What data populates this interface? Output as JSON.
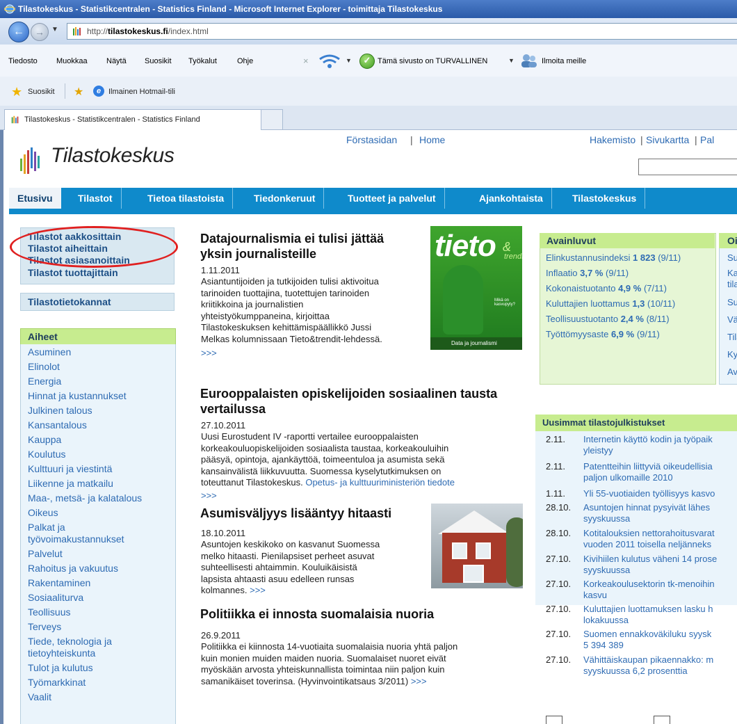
{
  "browser": {
    "title": "Tilastokeskus - Statistikcentralen - Statistics Finland - Microsoft Internet Explorer - toimittaja Tilastokeskus",
    "url_prefix": "http://",
    "url_host": "tilastokeskus.fi",
    "url_path": "/index.html",
    "menu": [
      "Tiedosto",
      "Muokkaa",
      "Näytä",
      "Suosikit",
      "Työkalut",
      "Ohje"
    ],
    "safe_site_text": "Tämä sivusto on TURVALLINEN",
    "report_text": "Ilmoita meille",
    "favorites_label": "Suosikit",
    "hotmail_label": "Ilmainen Hotmail-tili",
    "tab_label": "Tilastokeskus - Statistikcentralen - Statistics Finland"
  },
  "site": {
    "logo_text": "Tilastokeskus",
    "lang_links": [
      "Förstasidan",
      "Home"
    ],
    "util_links": [
      "Hakemisto",
      "Sivukartta",
      "Pal"
    ],
    "nav": [
      "Etusivu",
      "Tilastot",
      "Tietoa tilastoista",
      "Tiedonkeruut",
      "Tuotteet ja palvelut",
      "Ajankohtaista",
      "Tilastokeskus"
    ]
  },
  "left": {
    "stat_links": [
      "Tilastot aakkosittain",
      "Tilastot aiheittain",
      "Tilastot asiasanoittain",
      "Tilastot tuottajittain"
    ],
    "db_link": "Tilastotietokannat",
    "topics_heading": "Aiheet",
    "topics": [
      "Asuminen",
      "Elinolot",
      "Energia",
      "Hinnat ja kustannukset",
      "Julkinen talous",
      "Kansantalous",
      "Kauppa",
      "Koulutus",
      "Kulttuuri ja viestintä",
      "Liikenne ja matkailu",
      "Maa-, metsä- ja kalatalous",
      "Oikeus",
      "Palkat ja",
      "työvoimakustannukset",
      "Palvelut",
      "Rahoitus ja vakuutus",
      "Rakentaminen",
      "Sosiaaliturva",
      "Teollisuus",
      "Terveys",
      "Tiede, teknologia ja",
      "tietoyhteiskunta",
      "Tulot ja kulutus",
      "Työmarkkinat",
      "Vaalit"
    ]
  },
  "news": [
    {
      "title_lines": [
        "Datajournalismia ei tulisi jättää",
        "yksin journalisteille"
      ],
      "date": "1.11.2011",
      "body_lines": [
        "Asiantuntijoiden ja tutkijoiden tulisi aktivoitua",
        "tarinoiden tuottajina, tuotettujen tarinoiden",
        "kriitikkoina ja journalistien",
        "yhteistyökumppaneina, kirjoittaa",
        "Tilastokeskuksen kehittämispäällikkö Jussi",
        "Melkas kolumnissaan Tieto&trendit-lehdessä."
      ],
      "more": ">>>"
    },
    {
      "title_lines": [
        "Eurooppalaisten opiskelijoiden sosiaalinen tausta",
        "vertailussa"
      ],
      "date": "27.10.2011",
      "body_lines": [
        "Uusi Eurostudent IV -raportti vertailee eurooppalaisten",
        "korkeakouluopiskelijoiden sosiaalista taustaa, korkeakouluihin",
        "pääsyä, opintoja, ajankäyttöä, toimeentuloa ja asumista sekä",
        "kansainvälistä liikkuvuutta. Suomessa kyselytutkimuksen on",
        "toteuttanut Tilastokeskus."
      ],
      "link": "Opetus- ja kulttuuriministeriön tiedote",
      "more": ">>>"
    },
    {
      "title_lines": [
        "Asumisväljyys lisääntyy hitaasti"
      ],
      "date": "18.10.2011",
      "body_lines": [
        "Asuntojen keskikoko on kasvanut Suomessa",
        "melko hitaasti. Pienilapsiset perheet asuvat",
        "suhteellisesti ahtaimmin. Kouluikäisistä",
        "lapsista ahtaasti asuu edelleen runsas",
        "kolmannes."
      ],
      "more": ">>>"
    },
    {
      "title_lines": [
        "Politiikka ei innosta suomalaisia nuoria"
      ],
      "date": "26.9.2011",
      "body_lines": [
        "Politiikka ei kiinnosta 14-vuotiaita suomalaisia nuoria yhtä paljon",
        "kuin monien muiden maiden nuoria. Suomalaiset nuoret eivät",
        "myöskään arvosta yhteiskunnallista toimintaa niin paljon kuin",
        "samanikäiset toverinsa. (Hyvinvointikatsaus 3/2011)"
      ],
      "more": ">>>"
    }
  ],
  "tieto_cover": {
    "word": "tieto",
    "amp": "&",
    "trendit": "trendit",
    "side": "Mikä on kasvupyty?",
    "bottom": "Data ja journalismi"
  },
  "key_figures": {
    "heading": "Avainluvut",
    "rows": [
      {
        "label": "Elinkustannusindeksi",
        "value": "1 823",
        "period": "(9/11)"
      },
      {
        "label": "Inflaatio",
        "value": "3,7 %",
        "period": "(9/11)"
      },
      {
        "label": "Kokonaistuotanto",
        "value": "4,9 %",
        "period": "(7/11)"
      },
      {
        "label": "Kuluttajien luottamus",
        "value": "1,3",
        "period": "(10/11)"
      },
      {
        "label": "Teollisuustuotanto",
        "value": "2,4 %",
        "period": "(8/11)"
      },
      {
        "label": "Työttömyysaste",
        "value": "6,9 %",
        "period": "(9/11)"
      }
    ]
  },
  "oik": {
    "heading": "Oi",
    "items": [
      "Su",
      "Ka",
      "tila",
      "Su",
      "Vä",
      "Tila",
      "Ky",
      "Av"
    ]
  },
  "releases": {
    "heading": "Uusimmat tilastojulkistukset",
    "items": [
      {
        "date": "2.11.",
        "lines": [
          "Internetin käyttö kodin ja työpaik",
          "yleistyy"
        ]
      },
      {
        "date": "2.11.",
        "lines": [
          "Patentteihin liittyviä oikeudellisia",
          "paljon ulkomaille 2010"
        ]
      },
      {
        "date": "1.11.",
        "lines": [
          "Yli 55-vuotiaiden työllisyys kasvo"
        ]
      },
      {
        "date": "28.10.",
        "lines": [
          "Asuntojen hinnat pysyivät lähes",
          "syyskuussa"
        ]
      },
      {
        "date": "28.10.",
        "lines": [
          "Kotitalouksien nettorahoitusvarat",
          "vuoden 2011 toisella neljänneks"
        ]
      },
      {
        "date": "27.10.",
        "lines": [
          "Kivihiilen kulutus väheni 14 prose",
          "syyskuussa"
        ]
      },
      {
        "date": "27.10.",
        "lines": [
          "Korkeakoulusektorin tk-menoihin",
          "kasvu"
        ]
      },
      {
        "date": "27.10.",
        "lines": [
          "Kuluttajien luottamuksen lasku h",
          "lokakuussa"
        ]
      },
      {
        "date": "27.10.",
        "lines": [
          "Suomen ennakkoväkiluku syysk",
          "5 394 389"
        ]
      },
      {
        "date": "27.10.",
        "lines": [
          "Vähittäiskaupan pikaennakko: m",
          "syyskuussa 6,2 prosenttia"
        ]
      }
    ]
  }
}
